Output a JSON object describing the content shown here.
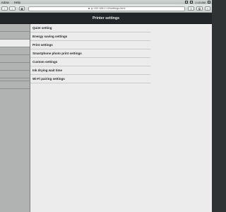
{
  "menubar": {
    "items": [
      "ndow",
      "Help"
    ],
    "clock": "1:15 AM"
  },
  "browser": {
    "address": "ip 192.168.1.10/settings.html"
  },
  "app": {
    "title": "Printer settings"
  },
  "settings": {
    "items": [
      {
        "label": "Quiet setting"
      },
      {
        "label": "Energy saving settings"
      },
      {
        "label": "Print settings"
      },
      {
        "label": "Smartphone photo print settings"
      },
      {
        "label": "Custom settings"
      },
      {
        "label": "Ink drying wait time"
      },
      {
        "label": "Wi-Fi pairing settings"
      }
    ]
  }
}
